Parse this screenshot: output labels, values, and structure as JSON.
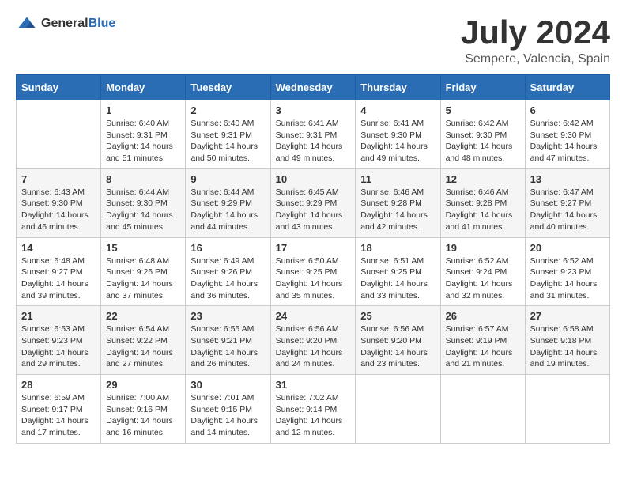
{
  "logo": {
    "general": "General",
    "blue": "Blue"
  },
  "title": "July 2024",
  "subtitle": "Sempere, Valencia, Spain",
  "days_header": [
    "Sunday",
    "Monday",
    "Tuesday",
    "Wednesday",
    "Thursday",
    "Friday",
    "Saturday"
  ],
  "weeks": [
    [
      {
        "day": "",
        "info": ""
      },
      {
        "day": "1",
        "info": "Sunrise: 6:40 AM\nSunset: 9:31 PM\nDaylight: 14 hours\nand 51 minutes."
      },
      {
        "day": "2",
        "info": "Sunrise: 6:40 AM\nSunset: 9:31 PM\nDaylight: 14 hours\nand 50 minutes."
      },
      {
        "day": "3",
        "info": "Sunrise: 6:41 AM\nSunset: 9:31 PM\nDaylight: 14 hours\nand 49 minutes."
      },
      {
        "day": "4",
        "info": "Sunrise: 6:41 AM\nSunset: 9:30 PM\nDaylight: 14 hours\nand 49 minutes."
      },
      {
        "day": "5",
        "info": "Sunrise: 6:42 AM\nSunset: 9:30 PM\nDaylight: 14 hours\nand 48 minutes."
      },
      {
        "day": "6",
        "info": "Sunrise: 6:42 AM\nSunset: 9:30 PM\nDaylight: 14 hours\nand 47 minutes."
      }
    ],
    [
      {
        "day": "7",
        "info": "Sunrise: 6:43 AM\nSunset: 9:30 PM\nDaylight: 14 hours\nand 46 minutes."
      },
      {
        "day": "8",
        "info": "Sunrise: 6:44 AM\nSunset: 9:30 PM\nDaylight: 14 hours\nand 45 minutes."
      },
      {
        "day": "9",
        "info": "Sunrise: 6:44 AM\nSunset: 9:29 PM\nDaylight: 14 hours\nand 44 minutes."
      },
      {
        "day": "10",
        "info": "Sunrise: 6:45 AM\nSunset: 9:29 PM\nDaylight: 14 hours\nand 43 minutes."
      },
      {
        "day": "11",
        "info": "Sunrise: 6:46 AM\nSunset: 9:28 PM\nDaylight: 14 hours\nand 42 minutes."
      },
      {
        "day": "12",
        "info": "Sunrise: 6:46 AM\nSunset: 9:28 PM\nDaylight: 14 hours\nand 41 minutes."
      },
      {
        "day": "13",
        "info": "Sunrise: 6:47 AM\nSunset: 9:27 PM\nDaylight: 14 hours\nand 40 minutes."
      }
    ],
    [
      {
        "day": "14",
        "info": "Sunrise: 6:48 AM\nSunset: 9:27 PM\nDaylight: 14 hours\nand 39 minutes."
      },
      {
        "day": "15",
        "info": "Sunrise: 6:48 AM\nSunset: 9:26 PM\nDaylight: 14 hours\nand 37 minutes."
      },
      {
        "day": "16",
        "info": "Sunrise: 6:49 AM\nSunset: 9:26 PM\nDaylight: 14 hours\nand 36 minutes."
      },
      {
        "day": "17",
        "info": "Sunrise: 6:50 AM\nSunset: 9:25 PM\nDaylight: 14 hours\nand 35 minutes."
      },
      {
        "day": "18",
        "info": "Sunrise: 6:51 AM\nSunset: 9:25 PM\nDaylight: 14 hours\nand 33 minutes."
      },
      {
        "day": "19",
        "info": "Sunrise: 6:52 AM\nSunset: 9:24 PM\nDaylight: 14 hours\nand 32 minutes."
      },
      {
        "day": "20",
        "info": "Sunrise: 6:52 AM\nSunset: 9:23 PM\nDaylight: 14 hours\nand 31 minutes."
      }
    ],
    [
      {
        "day": "21",
        "info": "Sunrise: 6:53 AM\nSunset: 9:23 PM\nDaylight: 14 hours\nand 29 minutes."
      },
      {
        "day": "22",
        "info": "Sunrise: 6:54 AM\nSunset: 9:22 PM\nDaylight: 14 hours\nand 27 minutes."
      },
      {
        "day": "23",
        "info": "Sunrise: 6:55 AM\nSunset: 9:21 PM\nDaylight: 14 hours\nand 26 minutes."
      },
      {
        "day": "24",
        "info": "Sunrise: 6:56 AM\nSunset: 9:20 PM\nDaylight: 14 hours\nand 24 minutes."
      },
      {
        "day": "25",
        "info": "Sunrise: 6:56 AM\nSunset: 9:20 PM\nDaylight: 14 hours\nand 23 minutes."
      },
      {
        "day": "26",
        "info": "Sunrise: 6:57 AM\nSunset: 9:19 PM\nDaylight: 14 hours\nand 21 minutes."
      },
      {
        "day": "27",
        "info": "Sunrise: 6:58 AM\nSunset: 9:18 PM\nDaylight: 14 hours\nand 19 minutes."
      }
    ],
    [
      {
        "day": "28",
        "info": "Sunrise: 6:59 AM\nSunset: 9:17 PM\nDaylight: 14 hours\nand 17 minutes."
      },
      {
        "day": "29",
        "info": "Sunrise: 7:00 AM\nSunset: 9:16 PM\nDaylight: 14 hours\nand 16 minutes."
      },
      {
        "day": "30",
        "info": "Sunrise: 7:01 AM\nSunset: 9:15 PM\nDaylight: 14 hours\nand 14 minutes."
      },
      {
        "day": "31",
        "info": "Sunrise: 7:02 AM\nSunset: 9:14 PM\nDaylight: 14 hours\nand 12 minutes."
      },
      {
        "day": "",
        "info": ""
      },
      {
        "day": "",
        "info": ""
      },
      {
        "day": "",
        "info": ""
      }
    ]
  ]
}
